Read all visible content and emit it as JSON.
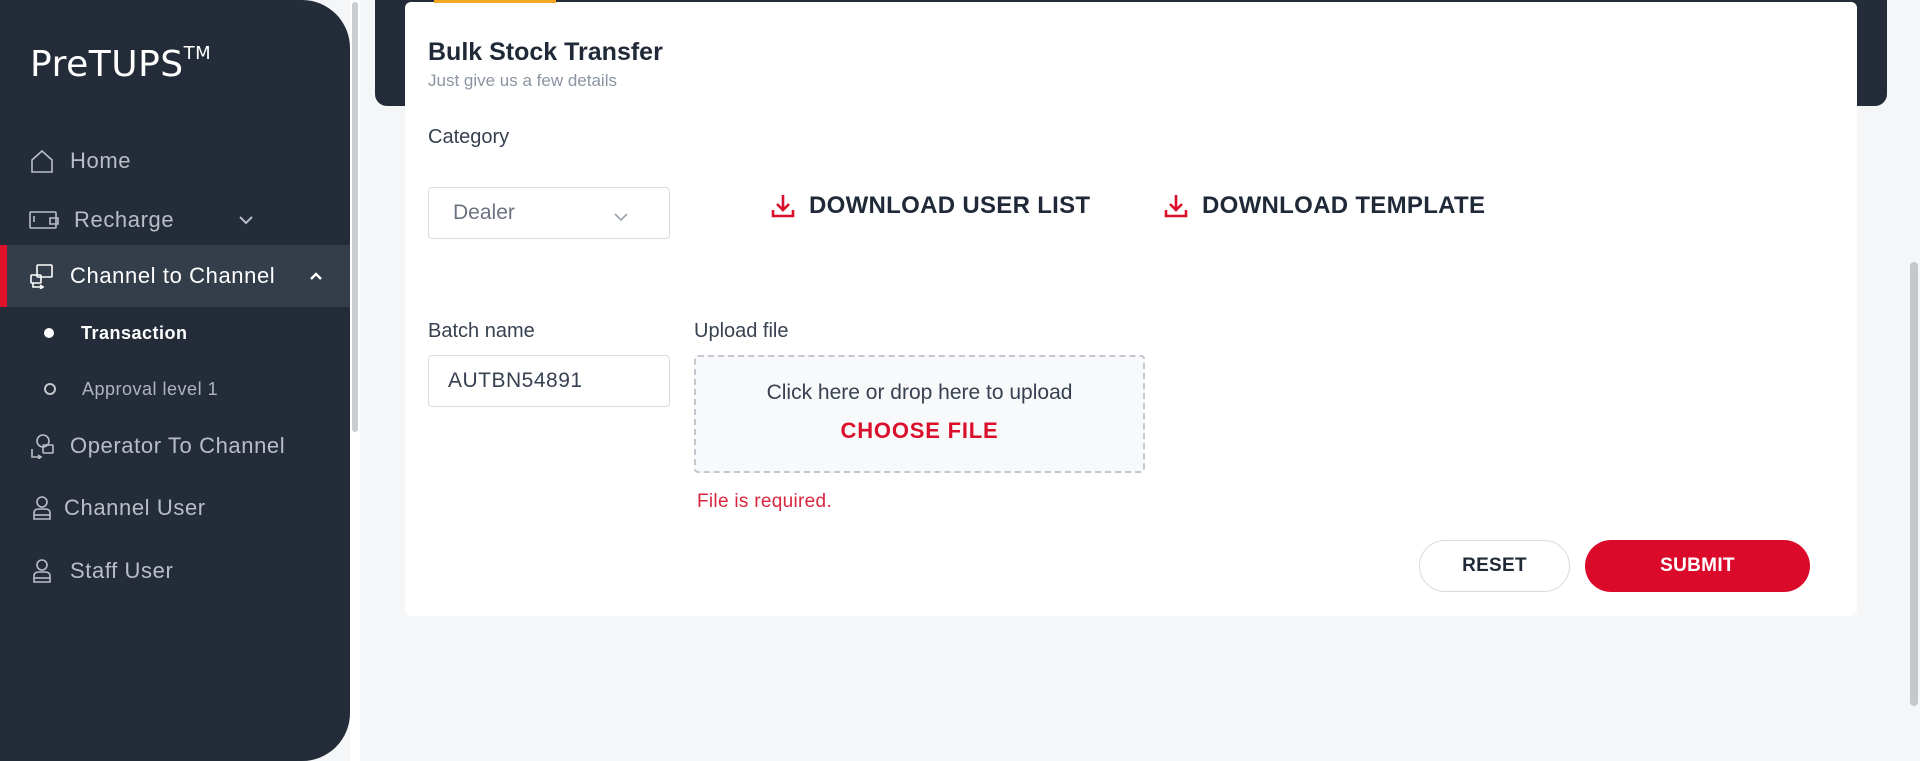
{
  "app": {
    "logo_text": "PreTUPS",
    "logo_tm": "TM"
  },
  "sidebar": {
    "items": [
      {
        "label": "Home",
        "icon": "home-icon"
      },
      {
        "label": "Recharge",
        "icon": "recharge-icon"
      },
      {
        "label": "Channel to Channel",
        "icon": "channel-transfer-icon"
      },
      {
        "label": "Operator To Channel",
        "icon": "operator-transfer-icon"
      },
      {
        "label": "Channel User",
        "icon": "user-icon"
      },
      {
        "label": "Staff User",
        "icon": "staff-user-icon"
      }
    ],
    "sub_items": [
      {
        "label": "Transaction",
        "active": true
      },
      {
        "label": "Approval level 1",
        "active": false
      }
    ]
  },
  "form": {
    "title": "Bulk Stock Transfer",
    "subtitle": "Just give us a few details",
    "category_label": "Category",
    "category_value": "Dealer",
    "download_user_list": "DOWNLOAD USER LIST",
    "download_template": "DOWNLOAD TEMPLATE",
    "batch_name_label": "Batch name",
    "batch_name_value": "AUTBN54891",
    "upload_label": "Upload file",
    "upload_hint": "Click here or drop here to upload",
    "choose_file": "CHOOSE FILE",
    "error": "File is required.",
    "reset": "RESET",
    "submit": "SUBMIT"
  },
  "colors": {
    "sidebar_bg": "#232c38",
    "accent_red": "#db0a2b",
    "tab_accent": "#f5a623"
  }
}
